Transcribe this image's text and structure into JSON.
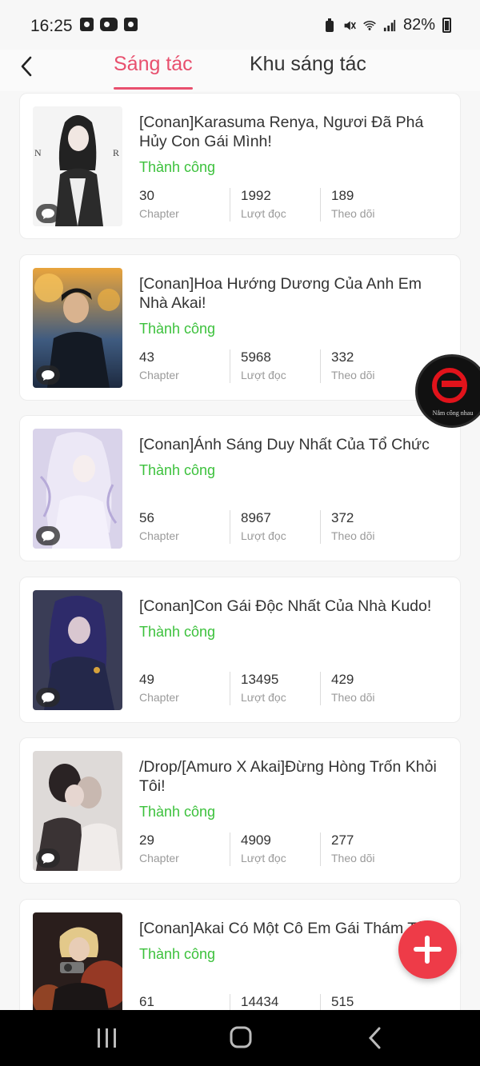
{
  "status_bar": {
    "time": "16:25",
    "battery": "82%"
  },
  "header": {
    "tabs": [
      {
        "label": "Sáng tác",
        "active": true
      },
      {
        "label": "Khu sáng tác",
        "active": false
      }
    ]
  },
  "stat_labels": {
    "chapters": "Chapter",
    "views": "Lượt đọc",
    "follows": "Theo dõi"
  },
  "stories": [
    {
      "title": "[Conan]Karasuma Renya, Ngươi Đã Phá Hủy Con Gái Mình!",
      "status": "Thành công",
      "chapters": "30",
      "views": "1992",
      "follows": "189"
    },
    {
      "title": "[Conan]Hoa Hướng Dương Của Anh Em Nhà Akai!",
      "status": "Thành công",
      "chapters": "43",
      "views": "5968",
      "follows": "332"
    },
    {
      "title": "[Conan]Ánh Sáng Duy Nhất Của Tổ Chức",
      "status": "Thành công",
      "chapters": "56",
      "views": "8967",
      "follows": "372"
    },
    {
      "title": "[Conan]Con Gái Độc Nhất Của Nhà Kudo!",
      "status": "Thành công",
      "chapters": "49",
      "views": "13495",
      "follows": "429"
    },
    {
      "title": "/Drop/[Amuro X Akai]Đừng Hòng Trốn Khỏi Tôi!",
      "status": "Thành công",
      "chapters": "29",
      "views": "4909",
      "follows": "277"
    },
    {
      "title": "[Conan]Akai Có Một Cô Em Gái Thám Tử",
      "status": "Thành công",
      "chapters": "61",
      "views": "14434",
      "follows": "515"
    }
  ],
  "floating_badge": {
    "caption": "Nắm công nhau"
  },
  "colors": {
    "accent": "#e8506e",
    "status_success": "#3cc13c",
    "fab": "#ee3b48"
  },
  "icons": [
    "back-arrow-icon",
    "comment-icon",
    "add-icon",
    "recents-icon",
    "home-icon",
    "nav-back-icon"
  ]
}
